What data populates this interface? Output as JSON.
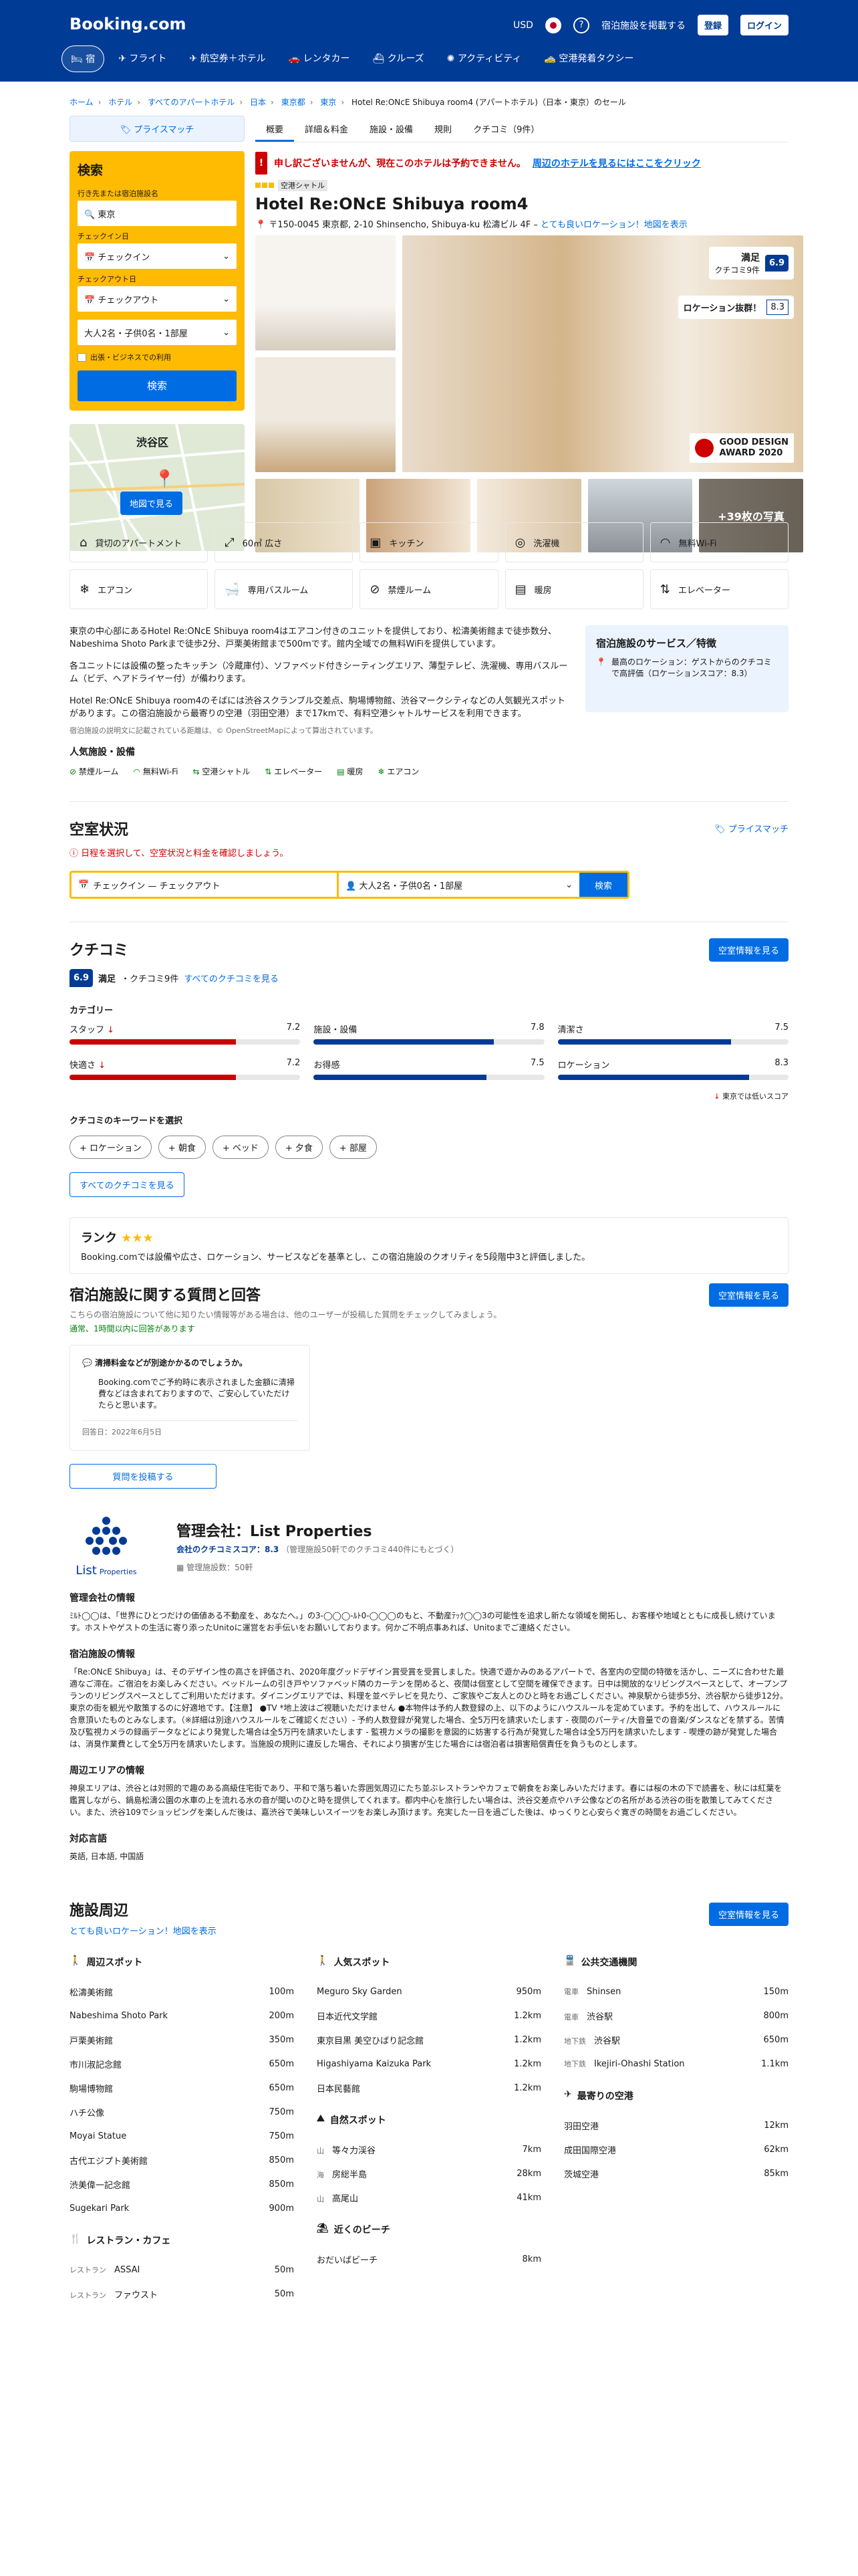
{
  "header": {
    "logo": "Booking.com",
    "currency": "USD",
    "list_property": "宿泊施設を掲載する",
    "register": "登録",
    "login": "ログイン",
    "nav": [
      {
        "label": "宿"
      },
      {
        "label": "フライト"
      },
      {
        "label": "航空券＋ホテル"
      },
      {
        "label": "レンタカー"
      },
      {
        "label": "クルーズ"
      },
      {
        "label": "アクティビティ"
      },
      {
        "label": "空港発着タクシー"
      }
    ]
  },
  "breadcrumb": [
    "ホーム",
    "ホテル",
    "すべてのアパートホテル",
    "日本",
    "東京都",
    "東京",
    "Hotel Re:ONcE Shibuya room4 (アパートホテル)（日本・東京）のセール"
  ],
  "sidebar": {
    "price_match": "プライスマッチ",
    "search_title": "検索",
    "dest_label": "行き先または宿泊施設名",
    "dest_value": "東京",
    "checkin_label": "チェックイン日",
    "checkin_value": "チェックイン",
    "checkout_label": "チェックアウト日",
    "checkout_value": "チェックアウト",
    "guests": "大人2名・子供0名・1部屋",
    "business": "出張・ビジネスでの利用",
    "search_btn": "検索",
    "map_btn": "地図で見る",
    "map_place": "渋谷区"
  },
  "tabs": [
    "概要",
    "詳細＆料金",
    "施設・設備",
    "規則",
    "クチコミ（9件）"
  ],
  "alert": {
    "text": "申し訳ございませんが、現在このホテルは予約できません。",
    "link": "周辺のホテルを見るにはここをクリック"
  },
  "property": {
    "tag": "空港シャトル",
    "name": "Hotel Re:ONcE Shibuya room4",
    "address": "〒150-0045 東京都, 2-10 Shinsencho, Shibuya-ku 松濤ビル 4F –",
    "address_link": "とても良いロケーション！地図を表示",
    "score_word": "満足",
    "score_count": "クチコミ9件",
    "score": "6.9",
    "loc_label": "ロケーション抜群！",
    "loc_score": "8.3",
    "award1": "GOOD DESIGN",
    "award2": "AWARD 2020",
    "more_photos": "+39枚の写真"
  },
  "facilities": [
    {
      "icon": "building-icon",
      "label": "貸切のアパートメント"
    },
    {
      "icon": "area-icon",
      "label": "60㎡ 広さ"
    },
    {
      "icon": "kitchen-icon",
      "label": "キッチン"
    },
    {
      "icon": "washer-icon",
      "label": "洗濯機"
    },
    {
      "icon": "wifi-icon",
      "label": "無料Wi-Fi"
    },
    {
      "icon": "ac-icon",
      "label": "エアコン"
    },
    {
      "icon": "bath-icon",
      "label": "専用バスルーム"
    },
    {
      "icon": "nosmoke-icon",
      "label": "禁煙ルーム"
    },
    {
      "icon": "heater-icon",
      "label": "暖房"
    },
    {
      "icon": "elevator-icon",
      "label": "エレベーター"
    }
  ],
  "description": {
    "p1": "東京の中心部にあるHotel Re:ONcE Shibuya room4はエアコン付きのユニットを提供しており、松濤美術館まで徒歩数分、Nabeshima Shoto Parkまで徒歩2分、戸栗美術館まで500mです。館内全域での無料WiFiを提供しています。",
    "p2": "各ユニットには設備の整ったキッチン（冷蔵庫付）、ソファベッド付きシーティングエリア、薄型テレビ、洗濯機、専用バスルーム（ビデ、ヘアドライヤー付）が備わります。",
    "p3": "Hotel Re:ONcE Shibuya room4のそばには渋谷スクランブル交差点、駒場博物館、渋谷マークシティなどの人気観光スポットがあります。この宿泊施設から最寄りの空港（羽田空港）まで17kmで、有料空港シャトルサービスを利用できます。",
    "p4": "宿泊施設の説明文に記載されている距離は、© OpenStreetMapによって算出されています。",
    "popular_title": "人気施設・設備",
    "popular": [
      "禁煙ルーム",
      "無料Wi-Fi",
      "空港シャトル",
      "エレベーター",
      "暖房",
      "エアコン"
    ]
  },
  "services": {
    "title": "宿泊施設のサービス／特徴",
    "text": "最高のロケーション：ゲストからのクチコミで高評価（ロケーションスコア：8.3）"
  },
  "availability": {
    "title": "空室状況",
    "price_match": "プライスマッチ",
    "note": "日程を選択して、空室状況と料金を確認しましょう。",
    "dates": "チェックイン — チェックアウト",
    "guests": "大人2名・子供0名・1部屋",
    "search": "検索"
  },
  "reviews": {
    "title": "クチコミ",
    "btn": "空室情報を見る",
    "score": "6.9",
    "word": "満足",
    "count": "・クチコミ9件",
    "all_link": "すべてのクチコミを見る",
    "cat_title": "カテゴリー",
    "low_note": "東京では低いスコア",
    "kw_title": "クチコミのキーワードを選択",
    "all_btn": "すべてのクチコミを見る",
    "categories": [
      {
        "label": "スタッフ",
        "score": "7.2",
        "value": 7.2,
        "color": "#c00",
        "low": "↓"
      },
      {
        "label": "施設・設備",
        "score": "7.8",
        "value": 7.8,
        "color": "#003b95",
        "low": ""
      },
      {
        "label": "清潔さ",
        "score": "7.5",
        "value": 7.5,
        "color": "#003b95",
        "low": ""
      },
      {
        "label": "快適さ",
        "score": "7.2",
        "value": 7.2,
        "color": "#c00",
        "low": "↓"
      },
      {
        "label": "お得感",
        "score": "7.5",
        "value": 7.5,
        "color": "#003b95",
        "low": ""
      },
      {
        "label": "ロケーション",
        "score": "8.3",
        "value": 8.3,
        "color": "#003b95",
        "low": ""
      }
    ],
    "keywords": [
      "ロケーション",
      "朝食",
      "ベッド",
      "夕食",
      "部屋"
    ]
  },
  "rank": {
    "title": "ランク",
    "text": "Booking.comでは設備や広さ、ロケーション、サービスなどを基準とし、この宿泊施設のクオリティを5段階中3と評価しました。"
  },
  "qa": {
    "title": "宿泊施設に関する質問と回答",
    "sub": "こちらの宿泊施設について他に知りたい情報等がある場合は、他のユーザーが投稿した質問をチェックしてみましょう。",
    "fast": "通常、1時間以内に回答があります",
    "q": "清掃料金などが別途かかるのでしょうか。",
    "a": "Booking.comでご予約時に表示されました金額に清掃費などは含まれておりますので、ご安心していただけたらと思います。",
    "date": "回答日：2022年6月5日",
    "post": "質問を投稿する",
    "btn": "空室情報を見る"
  },
  "manager": {
    "logo_text": "List",
    "logo_sub": "Properties",
    "title": "管理会社：List Properties",
    "score_label": "会社のクチコミスコア：8.3",
    "score_note": "（管理施設50軒でのクチコミ440件にもとづく）",
    "count": "管理施設数：50軒",
    "info_title": "管理会社の情報",
    "info": "ﾐﾙﾄ◯◯は、「世界にひとつだけの価値ある不動産を、あなたへ。」の3-◯◯◯-ﾙﾄ0-◯◯◯のもと、不動産ﾃｯｸ◯◯3の可能性を追求し新たな領域を開拓し、お客様や地域とともに成長し続けています。ホストやゲストの生活に寄り添ったUnitoに運営をお手伝いをお願いしております。何かご不明点事あれば、Unitoまでご連絡ください。",
    "prop_title": "宿泊施設の情報",
    "prop": "「Re:ONcE Shibuya」は、そのデザイン性の高さを評価され、2020年度グッドデザイン賞受賞を受賞しました。快適で遊かみのあるアパートで、各室内の空間の特徴を活かし、ニーズに合わせた最適なご滞在。ご宿泊をお楽しみください。ベッドルームの引き戸やソファベッド隣のカーテンを閉めると、夜間は個室として空間を確保できます。日中は開放的なリビングスペースとして、オープンプランのリビングスペースとしてご利用いただけます。ダイニングエリアでは、料理を並べテレビを見たり、ご家族やご友人とのひと時をお過ごしください。神泉駅から徒歩5分、渋谷駅から徒歩12分。東京の街を観光や散策するのに好適地です。【注意】 ●TV *地上波はご視聴いただけません ●本物件は予約人数登録の上、以下のようにハウスルールを定めています。予約を出して、ハウスルールに合意頂いたものとみなします。（※詳細は別途ハウスルールをご確認ください）- 予約人数登録が発覚した場合、全5万円を請求いたします - 夜間のパーティ/大音量での音楽/ダンスなどを禁ずる。苦情及び監視カメラの録画データなどにより発覚した場合は全5万円を請求いたします - 監視カメラの撮影を意図的に妨害する行為が発覚した場合は全5万円を請求いたします - 喫煙の跡が発覚した場合は、消臭作業費として全5万円を請求いたします。当施設の規則に違反した場合、それにより損害が生じた場合には宿泊者は損害賠償責任を負うものとします。",
    "area_title": "周辺エリアの情報",
    "area": "神泉エリアは、渋谷とは対照的で趣のある高級住宅街であり、平和で落ち着いた雰囲気周辺にたち並ぶレストランやカフェで朝食をお楽しみいただけます。春には桜の木の下で読書を、秋には紅葉を鑑賞しながら、鍋島松濤公園の水車の上を流れる水の音が聞いのひと時を提供してくれます。都内中心を旅行したい場合は、渋谷交差点やハチ公像などの名所がある渋谷の街を散策してみてください。また、渋谷109でショッピングを楽しんだ後は、嘉渋谷で美味しいスイーツをお楽しみ頂けます。充実した一日を過ごした後は、ゆっくりと心安らぐ寛ぎの時間をお過ごしください。",
    "lang_title": "対応言語",
    "lang": "英語, 日本語, 中国語"
  },
  "around": {
    "title": "施設周辺",
    "link": "とても良いロケーション！地図を表示",
    "btn": "空室情報を見る",
    "col1": [
      {
        "title": "周辺スポット",
        "items": [
          [
            "松濤美術館",
            "100m"
          ],
          [
            "Nabeshima Shoto Park",
            "200m"
          ],
          [
            "戸栗美術館",
            "350m"
          ],
          [
            "市川淑記念館",
            "650m"
          ],
          [
            "駒場博物館",
            "650m"
          ],
          [
            "ハチ公像",
            "750m"
          ],
          [
            "Moyai Statue",
            "750m"
          ],
          [
            "古代エジプト美術館",
            "850m"
          ],
          [
            "渋美偉一記念館",
            "850m"
          ],
          [
            "Sugekari Park",
            "900m"
          ]
        ]
      },
      {
        "title": "レストラン・カフェ",
        "items": [
          [
            "ASSAI",
            "50m",
            "レストラン"
          ],
          [
            "ファウスト",
            "50m",
            "レストラン"
          ]
        ]
      }
    ],
    "col2": [
      {
        "title": "人気スポット",
        "items": [
          [
            "Meguro Sky Garden",
            "950m"
          ],
          [
            "日本近代文学館",
            "1.2km"
          ],
          [
            "東京目黒 美空ひばり記念館",
            "1.2km"
          ],
          [
            "Higashiyama Kaizuka Park",
            "1.2km"
          ],
          [
            "日本民藝館",
            "1.2km"
          ]
        ]
      },
      {
        "title": "自然スポット",
        "items": [
          [
            "等々力渓谷",
            "7km",
            "山"
          ],
          [
            "房総半島",
            "28km",
            "海"
          ],
          [
            "高尾山",
            "41km",
            "山"
          ]
        ]
      },
      {
        "title": "近くのビーチ",
        "items": [
          [
            "おだいばビーチ",
            "8km"
          ]
        ]
      }
    ],
    "col3": [
      {
        "title": "公共交通機関",
        "items": [
          [
            "Shinsen",
            "150m",
            "電車"
          ],
          [
            "渋谷駅",
            "800m",
            "電車"
          ],
          [
            "渋谷駅",
            "650m",
            "地下鉄"
          ],
          [
            "Ikejiri-Ohashi Station",
            "1.1km",
            "地下鉄"
          ]
        ]
      },
      {
        "title": "最寄りの空港",
        "items": [
          [
            "羽田空港",
            "12km"
          ],
          [
            "成田国際空港",
            "62km"
          ],
          [
            "茨城空港",
            "85km"
          ]
        ]
      }
    ]
  }
}
